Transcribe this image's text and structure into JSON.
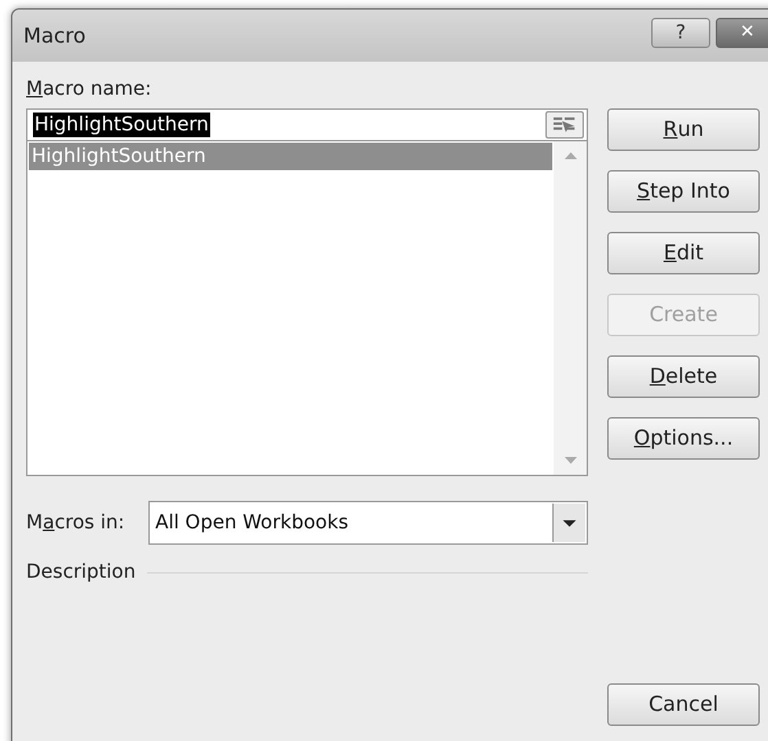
{
  "window": {
    "title": "Macro",
    "help_button": "?",
    "close_button": "✕"
  },
  "macro_name": {
    "label": {
      "key": "M",
      "rest": "acro name:"
    },
    "value": "HighlightSouthern"
  },
  "macro_list": [
    {
      "name": "HighlightSouthern",
      "selected": true
    }
  ],
  "buttons": [
    {
      "label": {
        "key": "R",
        "rest": "un"
      },
      "disabled": false
    },
    {
      "label": {
        "key": "S",
        "rest": "tep Into"
      },
      "disabled": false
    },
    {
      "label": {
        "key": "E",
        "rest": "dit"
      },
      "disabled": false
    },
    {
      "label": {
        "rest": "Create"
      },
      "disabled": true
    },
    {
      "label": {
        "key": "D",
        "rest": "elete"
      },
      "disabled": false
    },
    {
      "label": {
        "key": "O",
        "rest": "ptions..."
      },
      "disabled": false
    }
  ],
  "macros_in": {
    "label": {
      "lead": "M",
      "key": "a",
      "rest": "cros in:"
    },
    "value": "All Open Workbooks"
  },
  "description": {
    "label": "Description"
  },
  "cancel_button": {
    "label": "Cancel"
  }
}
